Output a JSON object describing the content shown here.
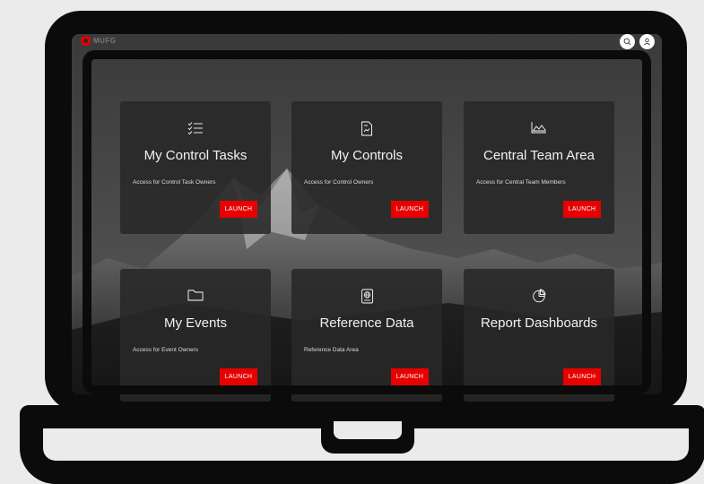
{
  "app": {
    "brand_name": "MUFG",
    "accent_color": "#e60000",
    "icons": [
      "search-icon",
      "user-icon"
    ]
  },
  "cards": [
    {
      "title": "My Control Tasks",
      "description": "Access for Control Task Owners",
      "button": "LAUNCH",
      "icon": "task-list-icon"
    },
    {
      "title": "My Controls",
      "description": "Access for Control Owners",
      "button": "LAUNCH",
      "icon": "document-icon"
    },
    {
      "title": "Central Team Area",
      "description": "Access for Central Team Members",
      "button": "LAUNCH",
      "icon": "area-chart-icon"
    },
    {
      "title": "My Events",
      "description": "Access for Event Owners",
      "button": "LAUNCH",
      "icon": "folder-icon"
    },
    {
      "title": "Reference Data",
      "description": "Reference Data Area",
      "button": "LAUNCH",
      "icon": "globe-book-icon"
    },
    {
      "title": "Report Dashboards",
      "description": "",
      "button": "LAUNCH",
      "icon": "pie-chart-icon"
    }
  ]
}
